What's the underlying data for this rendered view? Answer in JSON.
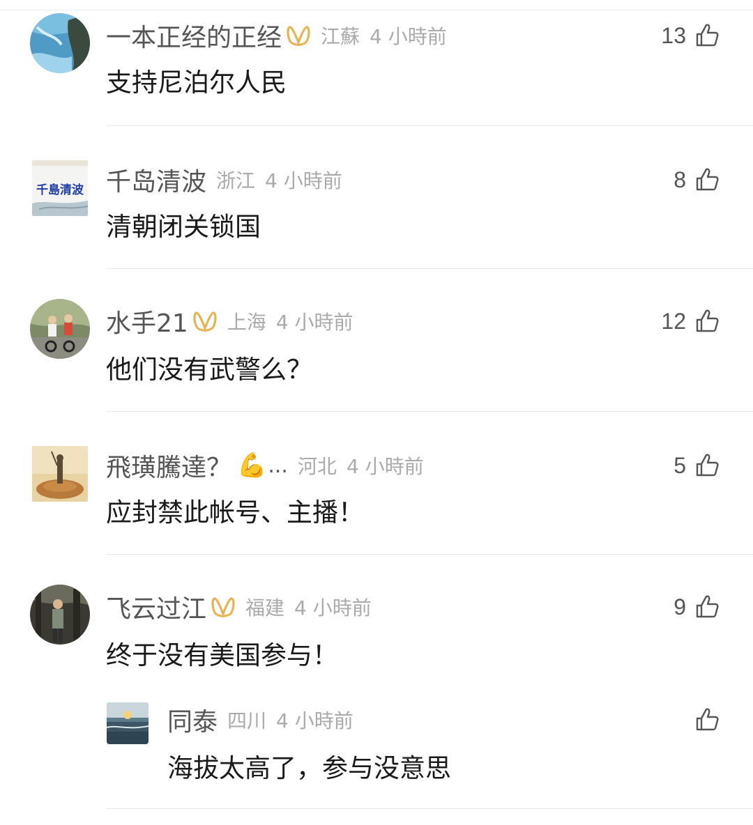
{
  "comments": [
    {
      "name": "一本正经的正经",
      "location": "江蘇",
      "time": "4 小時前",
      "likes": "13",
      "text": "支持尼泊尔人民",
      "vip": true
    },
    {
      "name": "千岛清波",
      "location": "浙江",
      "time": "4 小時前",
      "likes": "8",
      "text": "清朝闭关锁国",
      "vip": false,
      "avatar_text": "千島清波"
    },
    {
      "name": "水手21",
      "location": "上海",
      "time": "4 小時前",
      "likes": "12",
      "text": "他们没有武警么？",
      "vip": true
    },
    {
      "name": "飛璜騰達？",
      "location": "河北",
      "time": "4 小時前",
      "likes": "5",
      "text": "应封禁此帐号、主播！",
      "vip": false,
      "emoji": "💪",
      "ellipsis": "..."
    },
    {
      "name": "飞云过江",
      "location": "福建",
      "time": "4 小時前",
      "likes": "9",
      "text": "终于没有美国参与！",
      "vip": true
    }
  ],
  "reply": {
    "name": "同泰",
    "location": "四川",
    "time": "4 小時前",
    "text": "海拔太高了，参与没意思"
  },
  "icons": {
    "like": "thumbs-up-icon",
    "vip": "vip-badge-icon"
  },
  "colors": {
    "vip_badge": "#e7b451",
    "meta_gray": "#aaaaaa",
    "name_gray": "#555555"
  }
}
